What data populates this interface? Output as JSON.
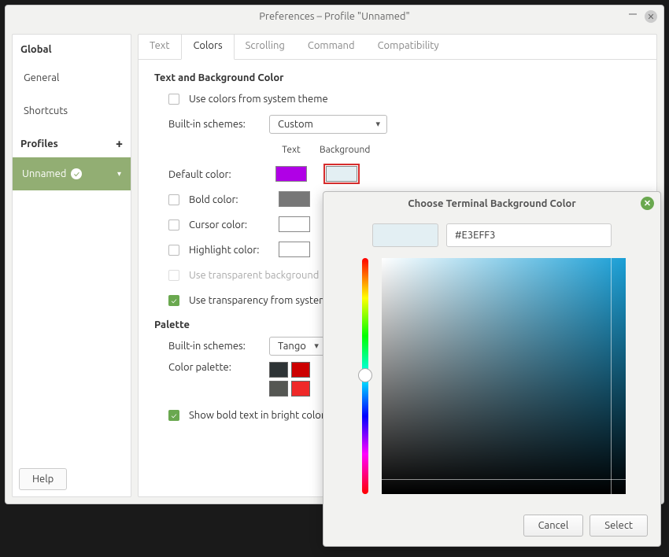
{
  "window": {
    "title": "Preferences – Profile \"Unnamed\""
  },
  "sidebar": {
    "global": "Global",
    "items": [
      "General",
      "Shortcuts"
    ],
    "profiles": "Profiles",
    "active_profile": "Unnamed",
    "help": "Help"
  },
  "tabs": [
    "Text",
    "Colors",
    "Scrolling",
    "Command",
    "Compatibility"
  ],
  "active_tab": 1,
  "colors_panel": {
    "section1": "Text and Background Color",
    "use_system": "Use colors from system theme",
    "builtin_label": "Built-in schemes:",
    "builtin_value": "Custom",
    "text_hdr": "Text",
    "bg_hdr": "Background",
    "default_color": "Default color:",
    "default_text_swatch": "#b000e6",
    "default_bg_swatch": "#e3eff3",
    "bold_color": "Bold color:",
    "bold_swatch": "#777777",
    "cursor_color": "Cursor color:",
    "cursor_swatch": "#ffffff",
    "highlight_color": "Highlight color:",
    "highlight_swatch": "#ffffff",
    "use_transparent": "Use transparent background",
    "use_system_trans": "Use transparency from system theme",
    "section2": "Palette",
    "palette_builtin_label": "Built-in schemes:",
    "palette_builtin_value": "Tango",
    "color_palette_label": "Color palette:",
    "palette_a1": "#2e3436",
    "palette_a2": "#cc0000",
    "palette_b1": "#555753",
    "palette_b2": "#ef2929",
    "show_bold_bright": "Show bold text in bright colors"
  },
  "color_dialog": {
    "title": "Choose Terminal Background Color",
    "hex": "#E3EFF3",
    "cancel": "Cancel",
    "select": "Select"
  }
}
